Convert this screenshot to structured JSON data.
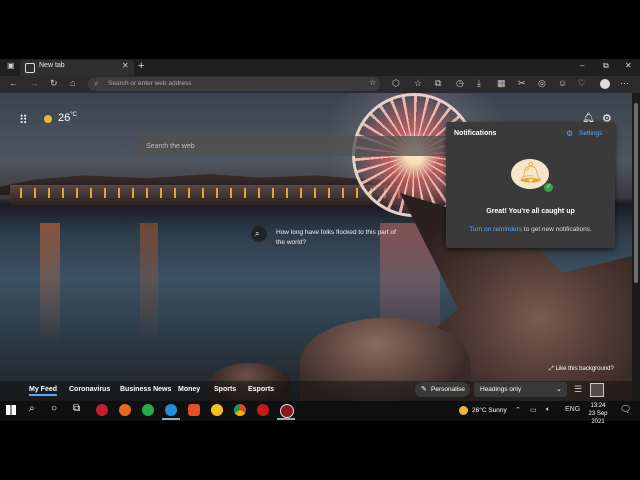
{
  "tab": {
    "title": "New tab",
    "close": "✕",
    "new": "+"
  },
  "window_controls": {
    "minimize": "–",
    "maximize": "⧉",
    "close": "✕"
  },
  "toolbar": {
    "address_placeholder": "Search or enter web address"
  },
  "weather": {
    "temperature": "26",
    "unit": "°C"
  },
  "search": {
    "placeholder": "Search the web"
  },
  "location_prompt": "How long have folks flocked to this part of the world?",
  "notifications": {
    "title": "Notifications",
    "settings_label": "Settings",
    "caught_up": "Great! You're all caught up",
    "sub_link": "Turn on reminders",
    "sub_text": " to get new notifications."
  },
  "like_background": "Like this background?",
  "feed": {
    "tabs": [
      "My Feed",
      "Coronavirus",
      "Business News",
      "Money",
      "Sports",
      "Esports"
    ],
    "personalise": "Personalise",
    "layout_select": "Headings only"
  },
  "taskbar": {
    "weather": "26°C  Sunny",
    "time": "13:24",
    "date": "23 Sep 2021"
  },
  "colors": {
    "accent": "#5aa6ff",
    "sun": "#f4b43c",
    "panel": "#3a3a3a"
  }
}
